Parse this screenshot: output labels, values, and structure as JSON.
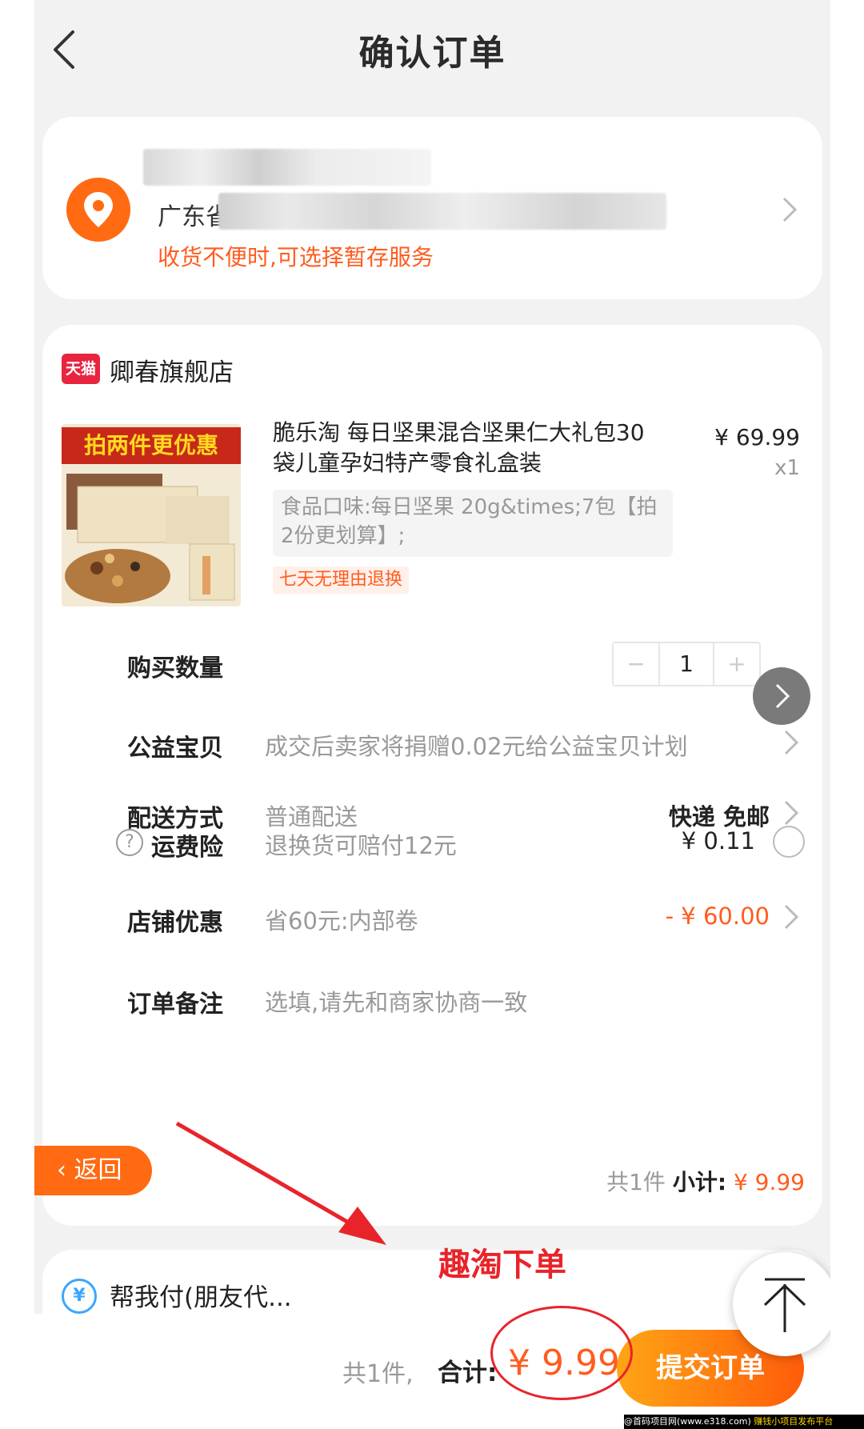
{
  "header": {
    "title": "确认订单"
  },
  "address": {
    "province": "广东省",
    "tip": "收货不便时,可选择暂存服务"
  },
  "shop": {
    "badge": "天猫",
    "name": "卿春旗舰店"
  },
  "product": {
    "image_banner": "拍两件更优惠",
    "title": "脆乐淘 每日坚果混合坚果仁大礼包30袋儿童孕妇特产零食礼盒装",
    "price": "¥ 69.99",
    "quantity_label": "x1",
    "spec": "食品口味:每日坚果 20g&times;7包【拍2份更划算】;",
    "refund_tag": "七天无理由退换"
  },
  "rows": {
    "quantity": {
      "label": "购买数量",
      "minus": "−",
      "value": "1",
      "plus": "+"
    },
    "charity": {
      "label": "公益宝贝",
      "value": "成交后卖家将捐赠0.02元给公益宝贝计划"
    },
    "delivery": {
      "label": "配送方式",
      "value": "普通配送",
      "right": "快递 免邮"
    },
    "insurance": {
      "help": "?",
      "label": "运费险",
      "value": "退换货可赔付12元",
      "right": "¥ 0.11"
    },
    "shop_discount": {
      "label": "店铺优惠",
      "value": "省60元:内部卷",
      "right": "- ¥ 60.00"
    },
    "remark": {
      "label": "订单备注",
      "placeholder": "选填,请先和商家协商一致"
    }
  },
  "subtotal": {
    "count": "共1件",
    "label": "小计:",
    "amount": "¥ 9.99"
  },
  "return_button": "‹ 返回",
  "pay_for_me": {
    "icon": "¥",
    "label": "帮我付(朋友代..."
  },
  "annotation": "趣淘下单",
  "bottom_bar": {
    "count": "共1件,",
    "total_label": "合计:",
    "total_amount": "¥ 9.99",
    "submit": "提交订单"
  },
  "watermark": {
    "left": "@首码项目网(www.e318.com)",
    "right": "赚钱小项目发布平台"
  },
  "colors": {
    "accent": "#ff5c1f",
    "annotation_red": "#e8242a",
    "tmall_red": "#e8243f"
  }
}
